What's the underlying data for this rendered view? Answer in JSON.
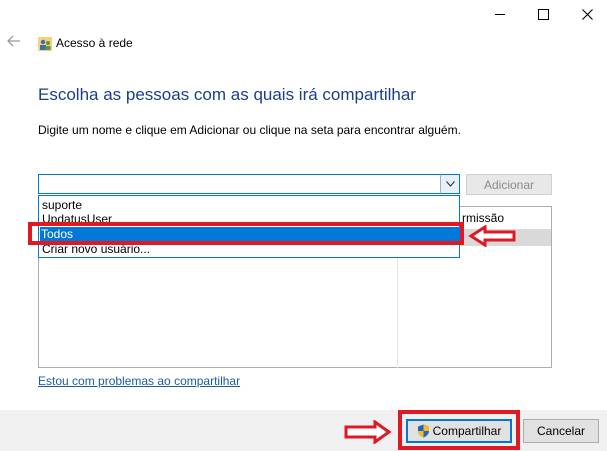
{
  "window": {
    "title": "Acesso à rede"
  },
  "page": {
    "heading": "Escolha as pessoas com as quais irá compartilhar",
    "instruction": "Digite um nome e clique em Adicionar ou clique na seta para encontrar alguém."
  },
  "name_input": {
    "value": ""
  },
  "add_button": {
    "label": "Adicionar",
    "enabled": false
  },
  "table": {
    "permission_header": "rmissão"
  },
  "dropdown": {
    "items": [
      "suporte",
      "UpdatusUser",
      "Todos",
      "Criar novo usuário..."
    ],
    "selected": "Todos"
  },
  "link": {
    "label": "Estou com problemas ao compartilhar"
  },
  "footer": {
    "share_label": "Compartilhar",
    "cancel_label": "Cancelar"
  },
  "colors": {
    "accent": "#0078d7",
    "heading": "#1b3e8e",
    "annotation": "#e01824"
  }
}
